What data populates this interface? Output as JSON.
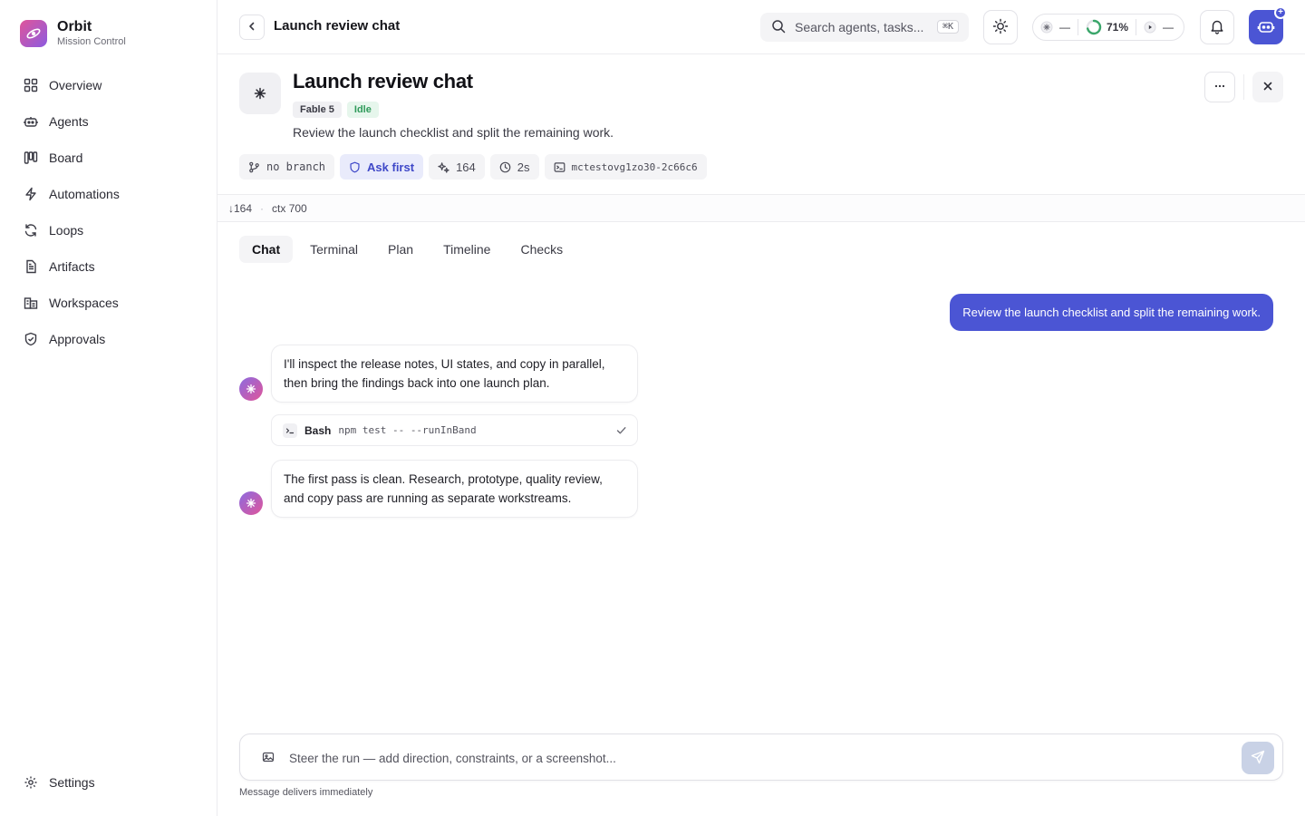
{
  "brand": {
    "name": "Orbit",
    "subtitle": "Mission Control"
  },
  "sidebar": {
    "items": [
      {
        "label": "Overview",
        "icon": "grid-icon"
      },
      {
        "label": "Agents",
        "icon": "robot-icon"
      },
      {
        "label": "Board",
        "icon": "kanban-icon"
      },
      {
        "label": "Automations",
        "icon": "bolt-icon"
      },
      {
        "label": "Loops",
        "icon": "refresh-icon"
      },
      {
        "label": "Artifacts",
        "icon": "document-icon"
      },
      {
        "label": "Workspaces",
        "icon": "building-icon"
      },
      {
        "label": "Approvals",
        "icon": "shield-check-icon"
      }
    ],
    "settings_label": "Settings"
  },
  "topbar": {
    "title": "Launch review chat",
    "search_placeholder": "Search agents, tasks...",
    "search_shortcut": "⌘K",
    "status": {
      "left_value": "—",
      "progress_percent": "71%",
      "progress_fraction": 0.71,
      "right_value": "—"
    }
  },
  "header": {
    "title": "Launch review chat",
    "model_badge": "Fable 5",
    "status_badge": "Idle",
    "description": "Review the launch checklist and split the remaining work.",
    "chips": {
      "branch": "no branch",
      "permission": "Ask first",
      "tokens": "164",
      "duration": "2s",
      "session": "mctestovg1zo30-2c66c6"
    }
  },
  "stats": {
    "tokens_down": "↓164",
    "context": "ctx 700"
  },
  "tabs": [
    {
      "label": "Chat",
      "active": true
    },
    {
      "label": "Terminal",
      "active": false
    },
    {
      "label": "Plan",
      "active": false
    },
    {
      "label": "Timeline",
      "active": false
    },
    {
      "label": "Checks",
      "active": false
    }
  ],
  "chat": {
    "user_message": "Review the launch checklist and split the remaining work.",
    "assistant_message_1": "I'll inspect the release notes, UI states, and copy in parallel, then bring the findings back into one launch plan.",
    "tool": {
      "name": "Bash",
      "command": "npm test -- --runInBand"
    },
    "assistant_message_2": "The first pass is clean. Research, prototype, quality review, and copy pass are running as separate workstreams."
  },
  "composer": {
    "placeholder": "Steer the run — add direction, constraints, or a screenshot...",
    "hint": "Message delivers immediately"
  },
  "colors": {
    "accent": "#4b55d4",
    "idle_green": "#2f9a5a",
    "progress_green": "#3aa66a"
  }
}
